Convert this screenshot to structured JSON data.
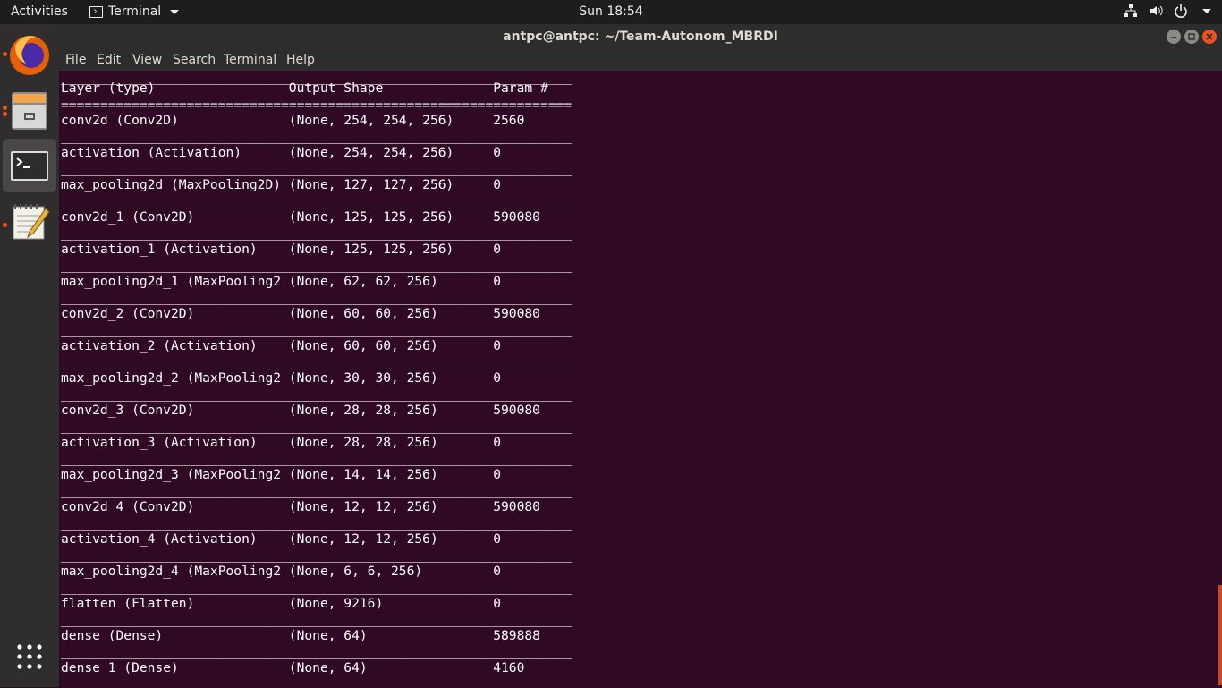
{
  "topbar": {
    "activities": "Activities",
    "app_name": "Terminal",
    "clock": "Sun 18:54"
  },
  "dock": {
    "items": [
      "firefox-icon",
      "files-icon",
      "terminal-icon",
      "text-editor-icon",
      "show-applications-icon"
    ]
  },
  "window": {
    "title": "antpc@antpc: ~/Team-Autonom_MBRDI",
    "menu": [
      "File",
      "Edit",
      "View",
      "Search",
      "Terminal",
      "Help"
    ]
  },
  "terminal": {
    "lines": [
      "_________________________________________________________________",
      "Layer (type)                 Output Shape              Param #   ",
      "=================================================================",
      "conv2d (Conv2D)              (None, 254, 254, 256)     2560      ",
      "_________________________________________________________________",
      "activation (Activation)      (None, 254, 254, 256)     0         ",
      "_________________________________________________________________",
      "max_pooling2d (MaxPooling2D) (None, 127, 127, 256)     0         ",
      "_________________________________________________________________",
      "conv2d_1 (Conv2D)            (None, 125, 125, 256)     590080    ",
      "_________________________________________________________________",
      "activation_1 (Activation)    (None, 125, 125, 256)     0         ",
      "_________________________________________________________________",
      "max_pooling2d_1 (MaxPooling2 (None, 62, 62, 256)       0         ",
      "_________________________________________________________________",
      "conv2d_2 (Conv2D)            (None, 60, 60, 256)       590080    ",
      "_________________________________________________________________",
      "activation_2 (Activation)    (None, 60, 60, 256)       0         ",
      "_________________________________________________________________",
      "max_pooling2d_2 (MaxPooling2 (None, 30, 30, 256)       0         ",
      "_________________________________________________________________",
      "conv2d_3 (Conv2D)            (None, 28, 28, 256)       590080    ",
      "_________________________________________________________________",
      "activation_3 (Activation)    (None, 28, 28, 256)       0         ",
      "_________________________________________________________________",
      "max_pooling2d_3 (MaxPooling2 (None, 14, 14, 256)       0         ",
      "_________________________________________________________________",
      "conv2d_4 (Conv2D)            (None, 12, 12, 256)       590080    ",
      "_________________________________________________________________",
      "activation_4 (Activation)    (None, 12, 12, 256)       0         ",
      "_________________________________________________________________",
      "max_pooling2d_4 (MaxPooling2 (None, 6, 6, 256)         0         ",
      "_________________________________________________________________",
      "flatten (Flatten)            (None, 9216)              0         ",
      "_________________________________________________________________",
      "dense (Dense)                (None, 64)                589888    ",
      "_________________________________________________________________",
      "dense_1 (Dense)              (None, 64)                4160      "
    ]
  },
  "colors": {
    "terminal_bg": "#300a24",
    "accent": "#e95420",
    "topbar_bg": "#1d1d1d",
    "dock_bg": "#2f2d2e"
  }
}
